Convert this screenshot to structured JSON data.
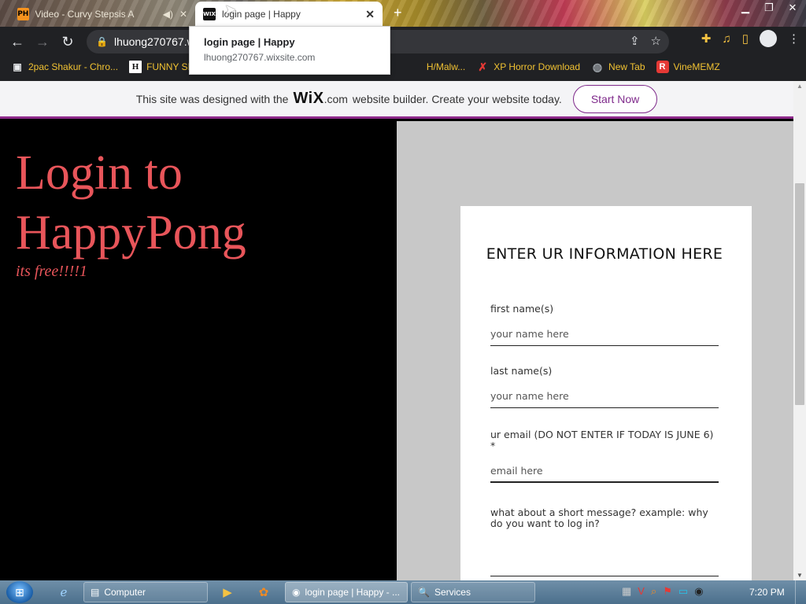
{
  "browser": {
    "tabs": [
      {
        "favicon": "PH",
        "title": "Video - Curvy Stepsis A",
        "active": false
      },
      {
        "favicon": "WIX",
        "title": "login page | Happy",
        "active": true
      }
    ],
    "new_tab_symbol": "+",
    "url": "lhuong270767.w",
    "tooltip": {
      "title": "login page | Happy",
      "url": "lhuong270767.wixsite.com"
    },
    "bookmarks": [
      {
        "icon": "store-icon",
        "label": "2pac Shakur - Chro..."
      },
      {
        "icon": "h-icon",
        "label": "FUNNY SI"
      },
      {
        "icon": "generic-icon",
        "label": "H/Malw..."
      },
      {
        "icon": "x-icon",
        "label": "XP Horror Download"
      },
      {
        "icon": "globe-icon",
        "label": "New Tab"
      },
      {
        "icon": "r-icon",
        "label": "VineMEMZ"
      }
    ]
  },
  "wix_banner": {
    "text_before": "This site was designed with the",
    "logo": "WiX",
    "dotcom": ".com",
    "text_after": "website builder. Create your website today.",
    "button": "Start Now",
    "accent_color": "#8e2a8b"
  },
  "hero": {
    "title": "Login to HappyPong",
    "subtitle": "its free!!!!1",
    "title_color": "#e8555a"
  },
  "form": {
    "heading": "ENTER UR INFORMATION HERE",
    "fields": [
      {
        "label": "first name(s)",
        "placeholder": "your name here"
      },
      {
        "label": "last name(s)",
        "placeholder": "your name here"
      },
      {
        "label": "ur email (DO NOT ENTER IF TODAY IS JUNE 6) *",
        "placeholder": "email here"
      },
      {
        "label": "what about a short message? example: why do you want to log in?",
        "placeholder": ""
      }
    ]
  },
  "taskbar": {
    "items": [
      {
        "icon": "folder-icon",
        "label": "Computer"
      },
      {
        "icon": "chrome-icon",
        "label": "login page | Happy - ..."
      },
      {
        "icon": "search-icon",
        "label": "Services"
      }
    ],
    "clock": "7:20 PM"
  }
}
